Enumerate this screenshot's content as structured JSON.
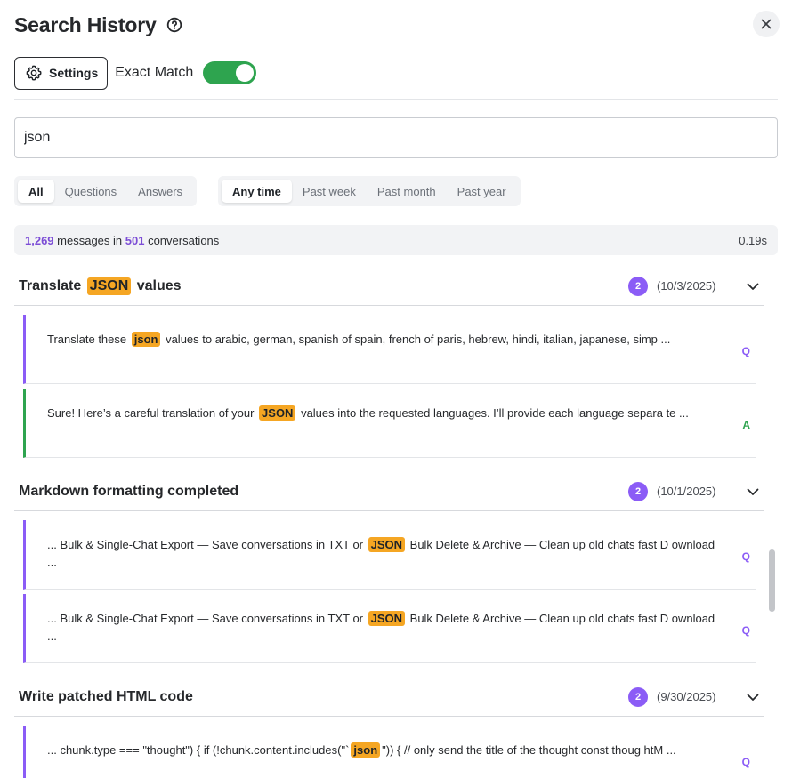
{
  "header": {
    "title": "Search History",
    "help_icon": "question-circle-icon",
    "close_icon": "close-icon"
  },
  "toolbar": {
    "settings_label": "Settings",
    "settings_icon": "gear-icon",
    "exact_match_label": "Exact Match",
    "exact_match_on": true
  },
  "search": {
    "value": "json"
  },
  "filters": {
    "type": [
      "All",
      "Questions",
      "Answers"
    ],
    "type_selected": "All",
    "time": [
      "Any time",
      "Past week",
      "Past month",
      "Past year"
    ],
    "time_selected": "Any time"
  },
  "stats": {
    "messages": "1,269",
    "messages_suffix": " messages in ",
    "conversations": "501",
    "conversations_suffix": " conversations",
    "duration": "0.19s"
  },
  "colors": {
    "accent": "#8b5cf6",
    "answer": "#2ea44f",
    "highlight": "#f5a623",
    "toggle": "#2ea44f"
  },
  "groups": [
    {
      "title_before": "Translate ",
      "title_match": "JSON",
      "title_after": " values",
      "count": "2",
      "date": "(10/3/2025)",
      "messages": [
        {
          "role": "Q",
          "before": "Translate these ",
          "match": "json",
          "after": " values to arabic, german, spanish of spain, french of paris, hebrew, hindi, italian, japanese, simp ..."
        },
        {
          "role": "A",
          "before": "Sure! Here’s a careful translation of your ",
          "match": "JSON",
          "after": " values into the requested languages. I’ll provide each language separa te ..."
        }
      ]
    },
    {
      "title_before": "Markdown formatting completed",
      "title_match": "",
      "title_after": "",
      "count": "2",
      "date": "(10/1/2025)",
      "messages": [
        {
          "role": "Q",
          "before": "... Bulk & Single-Chat Export — Save conversations in TXT or ",
          "match": "JSON",
          "after": " Bulk Delete & Archive — Clean up old chats fast D ownload ..."
        },
        {
          "role": "Q",
          "before": "... Bulk & Single-Chat Export — Save conversations in TXT or ",
          "match": "JSON",
          "after": " Bulk Delete & Archive — Clean up old chats fast D ownload ..."
        }
      ]
    },
    {
      "title_before": "Write patched HTML code",
      "title_match": "",
      "title_after": "",
      "count": "2",
      "date": "(9/30/2025)",
      "messages": [
        {
          "role": "Q",
          "before": "... chunk.type === \"thought\") { if (!chunk.content.includes(\"`",
          "match": "json",
          "after": "\")) { // only send the title of the thought const thoug htM ..."
        }
      ]
    }
  ]
}
